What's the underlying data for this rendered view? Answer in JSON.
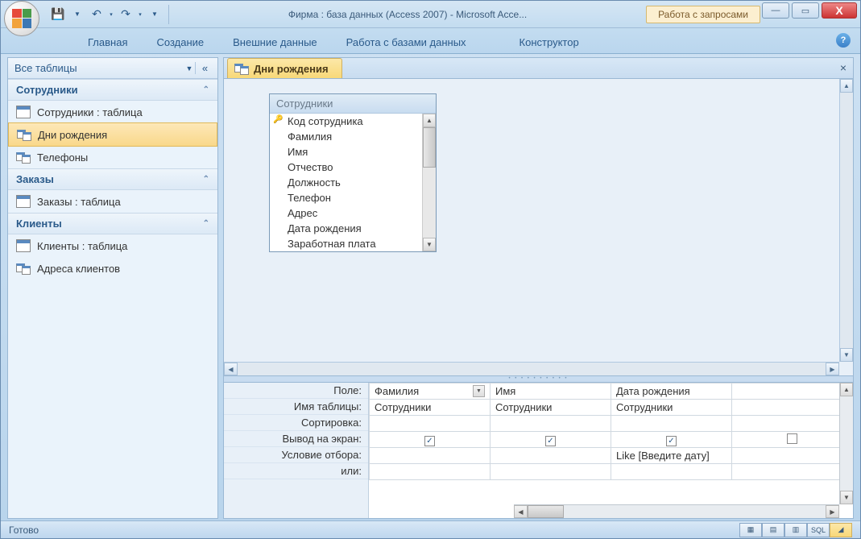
{
  "titlebar": {
    "app_title": "Фирма : база данных (Access 2007)  -  Microsoft Acce...",
    "contextual_tab": "Работа с запросами"
  },
  "ribbon": {
    "tabs": [
      "Главная",
      "Создание",
      "Внешние данные",
      "Работа с базами данных",
      "Конструктор"
    ]
  },
  "nav": {
    "title": "Все таблицы",
    "groups": [
      {
        "name": "Сотрудники",
        "items": [
          {
            "label": "Сотрудники : таблица",
            "icon": "table"
          },
          {
            "label": "Дни рождения",
            "icon": "query",
            "selected": true
          },
          {
            "label": "Телефоны",
            "icon": "query"
          }
        ]
      },
      {
        "name": "Заказы",
        "items": [
          {
            "label": "Заказы : таблица",
            "icon": "table"
          }
        ]
      },
      {
        "name": "Клиенты",
        "items": [
          {
            "label": "Клиенты : таблица",
            "icon": "table"
          },
          {
            "label": "Адреса клиентов",
            "icon": "query"
          }
        ]
      }
    ]
  },
  "document": {
    "tab_label": "Дни рождения",
    "table_box": {
      "title": "Сотрудники",
      "fields": [
        "Код сотрудника",
        "Фамилия",
        "Имя",
        "Отчество",
        "Должность",
        "Телефон",
        "Адрес",
        "Дата рождения",
        "Заработная плата"
      ],
      "key_field_index": 0
    }
  },
  "design_grid": {
    "row_labels": [
      "Поле:",
      "Имя таблицы:",
      "Сортировка:",
      "Вывод на экран:",
      "Условие отбора:",
      "или:"
    ],
    "columns": [
      {
        "field": "Фамилия",
        "table": "Сотрудники",
        "sort": "",
        "show": true,
        "criteria": "",
        "or": "",
        "dropdown": true
      },
      {
        "field": "Имя",
        "table": "Сотрудники",
        "sort": "",
        "show": true,
        "criteria": "",
        "or": ""
      },
      {
        "field": "Дата рождения",
        "table": "Сотрудники",
        "sort": "",
        "show": true,
        "criteria": "Like [Введите дату]",
        "or": ""
      }
    ]
  },
  "statusbar": {
    "text": "Готово",
    "sql_label": "SQL"
  }
}
